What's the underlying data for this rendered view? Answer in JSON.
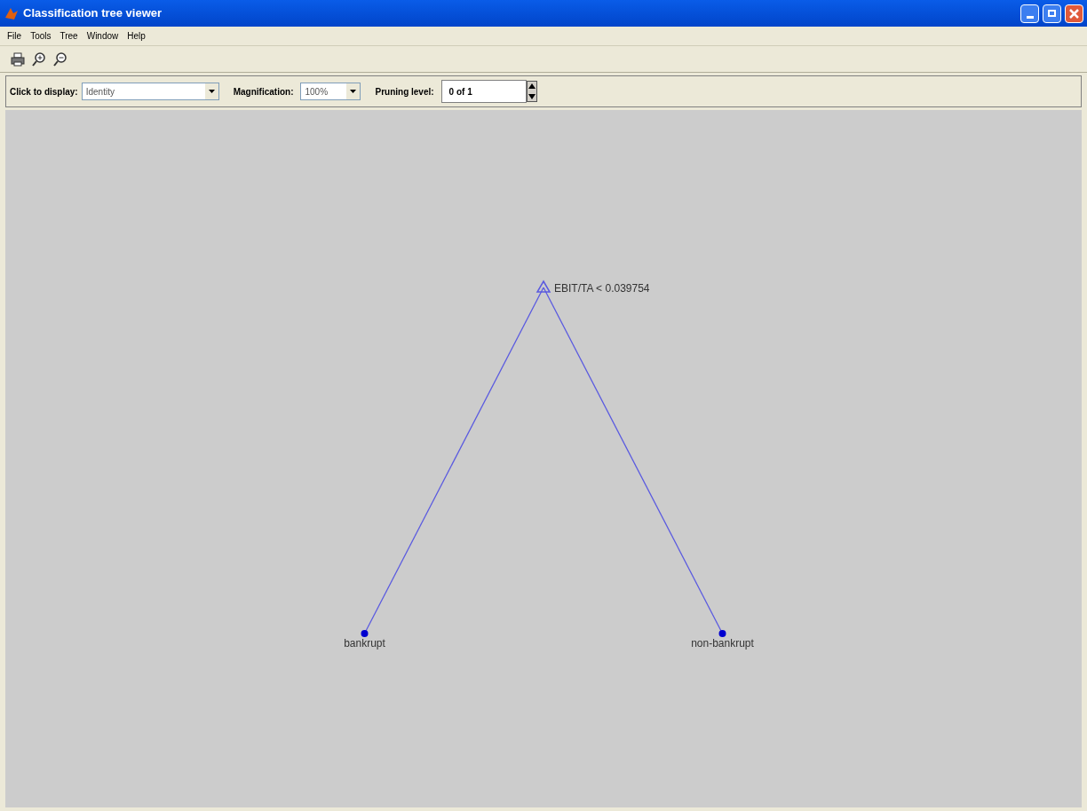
{
  "window": {
    "title": "Classification tree viewer"
  },
  "menu": [
    "File",
    "Tools",
    "Tree",
    "Window",
    "Help"
  ],
  "controls": {
    "display": {
      "label": "Click to display:",
      "value": "Identity"
    },
    "magnification": {
      "label": "Magnification:",
      "value": "100%"
    },
    "pruning": {
      "label": "Pruning level:",
      "value": "0 of 1"
    }
  },
  "tree": {
    "kind": "branch",
    "label": "EBIT/TA < 0.039754",
    "children": [
      {
        "kind": "leaf",
        "label": "bankrupt"
      },
      {
        "kind": "leaf",
        "label": "non-bankrupt"
      }
    ]
  }
}
